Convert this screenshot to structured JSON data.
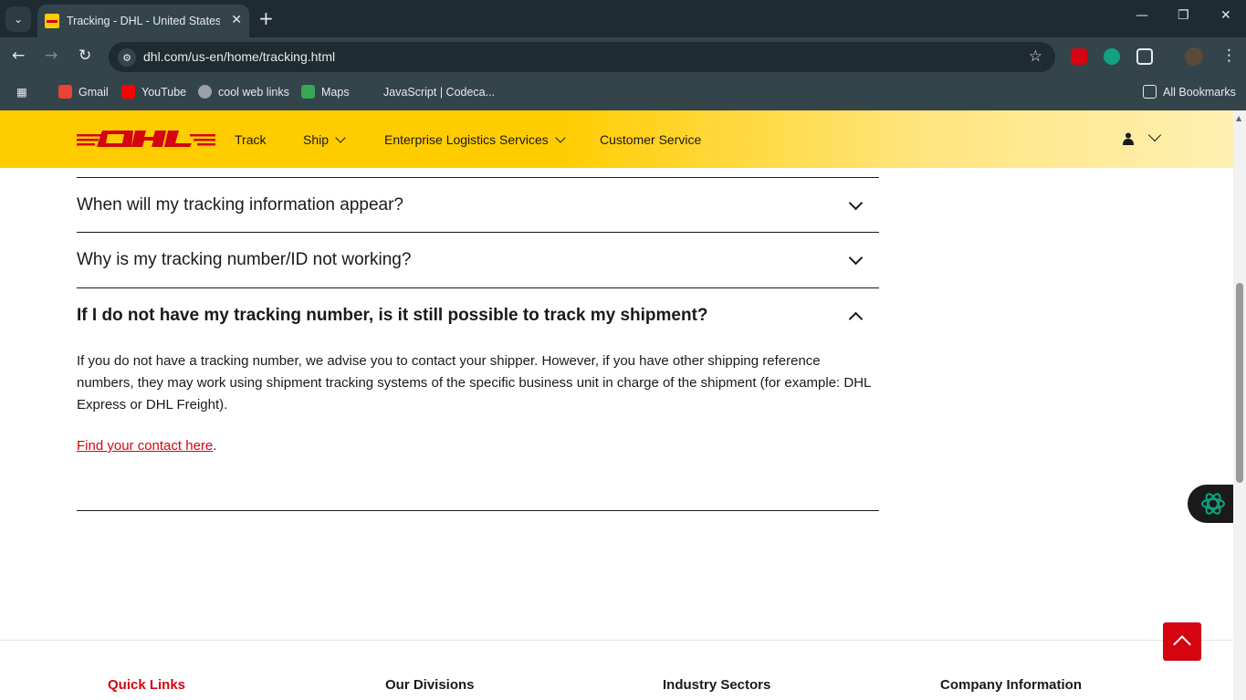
{
  "browser": {
    "tab_title": "Tracking - DHL - United States of America",
    "url": "dhl.com/us-en/home/tracking.html",
    "bookmarks": [
      "Gmail",
      "YouTube",
      "cool web links",
      "Maps",
      "JavaScript | Codeca..."
    ],
    "all_bookmarks": "All Bookmarks"
  },
  "header": {
    "nav": [
      "Track",
      "Ship",
      "Enterprise Logistics Services",
      "Customer Service"
    ]
  },
  "faq": {
    "items": [
      {
        "question": "When will my tracking information appear?",
        "expanded": false
      },
      {
        "question": "Why is my tracking number/ID not working?",
        "expanded": false
      },
      {
        "question": "If I do not have my tracking number, is it still possible to track my shipment?",
        "expanded": true
      }
    ],
    "answer": "If you do not have a tracking number, we advise you to contact your shipper. However, if you have other shipping reference numbers, they may work using shipment tracking systems of the specific business unit in charge of the shipment (for example: DHL Express or DHL Freight).",
    "contact_link": "Find your contact here",
    "contact_suffix": "."
  },
  "footer": {
    "columns": [
      "Quick Links",
      "Our Divisions",
      "Industry Sectors",
      "Company Information"
    ]
  },
  "colors": {
    "brand_yellow": "#ffcc00",
    "brand_red": "#d40511"
  }
}
